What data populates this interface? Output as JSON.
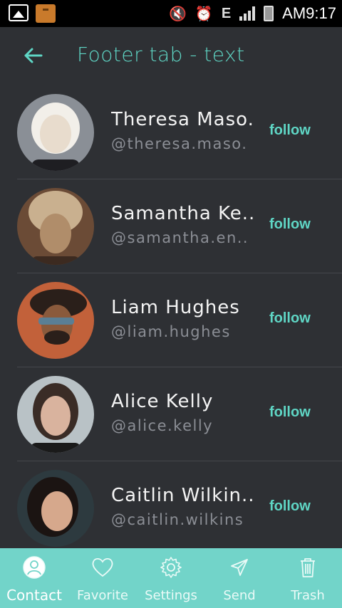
{
  "status_bar": {
    "time": "AM9:17",
    "network": "E"
  },
  "header": {
    "title": "Footer tab - text"
  },
  "contacts": [
    {
      "name": "Theresa Maso.",
      "handle": "@theresa.maso.",
      "action": "follow",
      "avatar_colors": [
        "#8a8f96",
        "#e8dccd",
        "#f2efe9"
      ]
    },
    {
      "name": "Samantha Ke..",
      "handle": "@samantha.en..",
      "action": "follow",
      "avatar_colors": [
        "#6b4b36",
        "#c9b08f",
        "#b08d6a"
      ]
    },
    {
      "name": "Liam Hughes",
      "handle": "@liam.hughes",
      "action": "follow",
      "avatar_colors": [
        "#c2613a",
        "#8a5a3c",
        "#2a1f1a"
      ]
    },
    {
      "name": "Alice Kelly",
      "handle": "@alice.kelly",
      "action": "follow",
      "avatar_colors": [
        "#b9c2c6",
        "#d9b39e",
        "#3a2c26"
      ]
    },
    {
      "name": "Caitlin Wilkin..",
      "handle": "@caitlin.wilkins",
      "action": "follow",
      "avatar_colors": [
        "#2d3a3f",
        "#d6a88c",
        "#1b1412"
      ]
    }
  ],
  "footer": {
    "tabs": [
      {
        "label": "Contact",
        "icon": "contact-icon",
        "active": true
      },
      {
        "label": "Favorite",
        "icon": "heart-icon",
        "active": false
      },
      {
        "label": "Settings",
        "icon": "gear-icon",
        "active": false
      },
      {
        "label": "Send",
        "icon": "send-icon",
        "active": false
      },
      {
        "label": "Trash",
        "icon": "trash-icon",
        "active": false
      }
    ]
  },
  "colors": {
    "accent": "#5fd6c5",
    "footer_bg": "#72d4c9",
    "background": "#2e3034"
  }
}
